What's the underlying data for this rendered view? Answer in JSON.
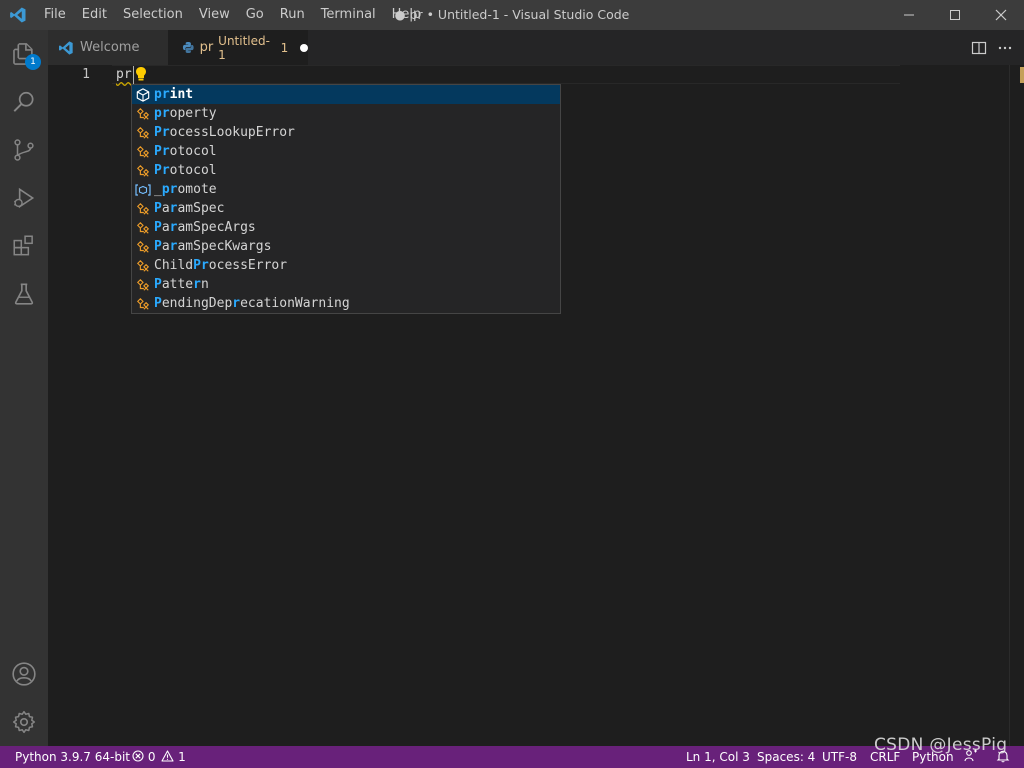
{
  "window": {
    "title": "● pr • Untitled-1 - Visual Studio Code"
  },
  "menu": [
    "File",
    "Edit",
    "Selection",
    "View",
    "Go",
    "Run",
    "Terminal",
    "Help"
  ],
  "activity_bar": {
    "explorer_badge": "1",
    "items": [
      "explorer-icon",
      "search-icon",
      "source-control-icon",
      "run-debug-icon",
      "extensions-icon",
      "testing-icon",
      "account-icon",
      "settings-gear-icon"
    ]
  },
  "tabs": [
    {
      "label": "Welcome",
      "icon": "vscode-logo-icon",
      "active": false
    },
    {
      "label_prefix": "pr",
      "label": "Untitled-1",
      "problem_count": "1",
      "icon": "python-icon",
      "active": true,
      "dirty": true
    }
  ],
  "editor": {
    "line_number": "1",
    "code": "pr"
  },
  "suggestions": [
    {
      "match": "pr",
      "rest": "int",
      "kind": "keyword",
      "selected": true
    },
    {
      "match": "pr",
      "rest": "operty",
      "kind": "class"
    },
    {
      "match": "Pr",
      "rest": "ocessLookupError",
      "kind": "class"
    },
    {
      "match": "Pr",
      "rest": "otocol",
      "kind": "class"
    },
    {
      "match": "Pr",
      "rest": "otocol",
      "kind": "class"
    },
    {
      "pre": "_",
      "match": "pr",
      "rest": "omote",
      "kind": "variable"
    },
    {
      "match": "P",
      "mid": "a",
      "match2": "r",
      "rest": "amSpec",
      "kind": "class"
    },
    {
      "match": "P",
      "mid": "a",
      "match2": "r",
      "rest": "amSpecArgs",
      "kind": "class"
    },
    {
      "match": "P",
      "mid": "a",
      "match2": "r",
      "rest": "amSpecKwargs",
      "kind": "class"
    },
    {
      "pre": "Child",
      "match": "Pr",
      "rest": "ocessError",
      "kind": "class"
    },
    {
      "match": "P",
      "mid": "atte",
      "match2": "r",
      "rest": "n",
      "kind": "class"
    },
    {
      "match": "P",
      "mid": "endingDep",
      "match2": "r",
      "rest": "ecationWarning",
      "kind": "class"
    }
  ],
  "status": {
    "interpreter": "Python 3.9.7 64-bit",
    "errors": "0",
    "warnings": "1",
    "position": "Ln 1, Col 3",
    "spaces": "Spaces: 4",
    "encoding": "UTF-8",
    "eol": "CRLF",
    "language": "Python"
  },
  "watermark": "CSDN @JessPig",
  "colors": {
    "status_bar": "#68217a",
    "accent_blue": "#2aaaff",
    "class_icon": "#ee9d28",
    "selection": "#04395e"
  }
}
